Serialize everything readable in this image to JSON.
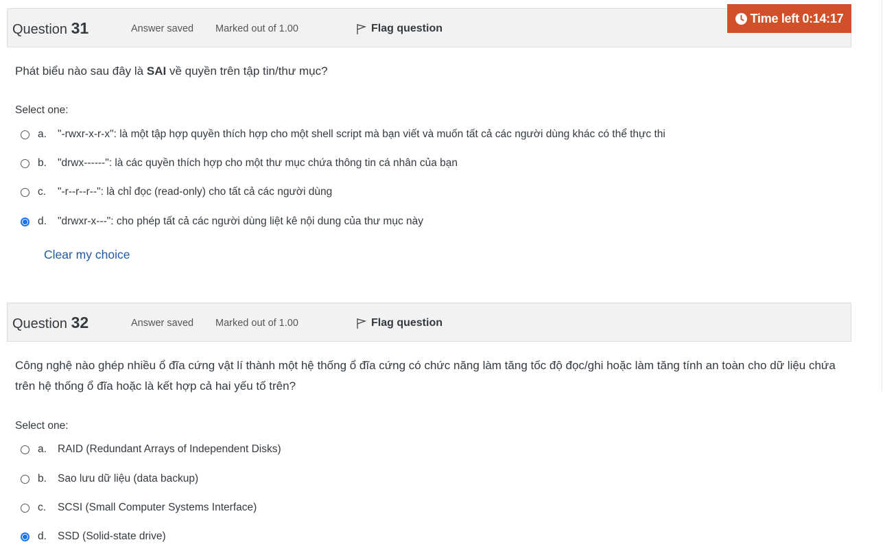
{
  "timer": {
    "label": "Time left 0:14:17"
  },
  "questions": [
    {
      "label": "Question",
      "number": "31",
      "state": "Answer saved",
      "grade": "Marked out of 1.00",
      "flag_label": "Flag question",
      "text_before": "Phát biểu nào sau đây là ",
      "text_bold": "SAI",
      "text_after": " về quyền trên tập tin/thư mục?",
      "select_label": "Select one:",
      "options": [
        {
          "letter": "a.",
          "text": "\"-rwxr-x-r-x\": là một tập hợp quyền thích hợp cho một shell script mà bạn viết và muốn tất cả các người dùng khác có thể thực thi",
          "selected": false
        },
        {
          "letter": "b.",
          "text": "\"drwx------\": là các quyền thích hợp cho một thư mục chứa thông tin cá nhân của bạn",
          "selected": false
        },
        {
          "letter": "c.",
          "text": "\"-r--r--r--\": là chỉ đọc (read-only) cho tất cả các người dùng",
          "selected": false
        },
        {
          "letter": "d.",
          "text": "\"drwxr-x---\": cho phép tất cả các người dùng liệt kê nội dung của thư mục này",
          "selected": true
        }
      ],
      "clear_label": "Clear my choice"
    },
    {
      "label": "Question",
      "number": "32",
      "state": "Answer saved",
      "grade": "Marked out of 1.00",
      "flag_label": "Flag question",
      "text": "Công nghệ nào ghép nhiều ổ đĩa cứng vật lí thành một hệ thống ổ đĩa cứng có chức năng làm tăng tốc độ đọc/ghi hoặc làm tăng tính an toàn cho dữ liệu chứa trên hệ thống ổ đĩa hoặc là kết hợp cả hai yếu tố trên?",
      "select_label": "Select one:",
      "options": [
        {
          "letter": "a.",
          "text": "RAID (Redundant Arrays of Independent Disks)",
          "selected": false
        },
        {
          "letter": "b.",
          "text": "Sao lưu dữ liệu (data backup)",
          "selected": false
        },
        {
          "letter": "c.",
          "text": "SCSI (Small Computer Systems Interface)",
          "selected": false
        },
        {
          "letter": "d.",
          "text": "SSD (Solid-state drive)",
          "selected": true
        }
      ]
    }
  ],
  "colors": {
    "timer_bg": "#d0502a",
    "link": "#1f5aa6",
    "radio_selected": "#1a73e8"
  }
}
